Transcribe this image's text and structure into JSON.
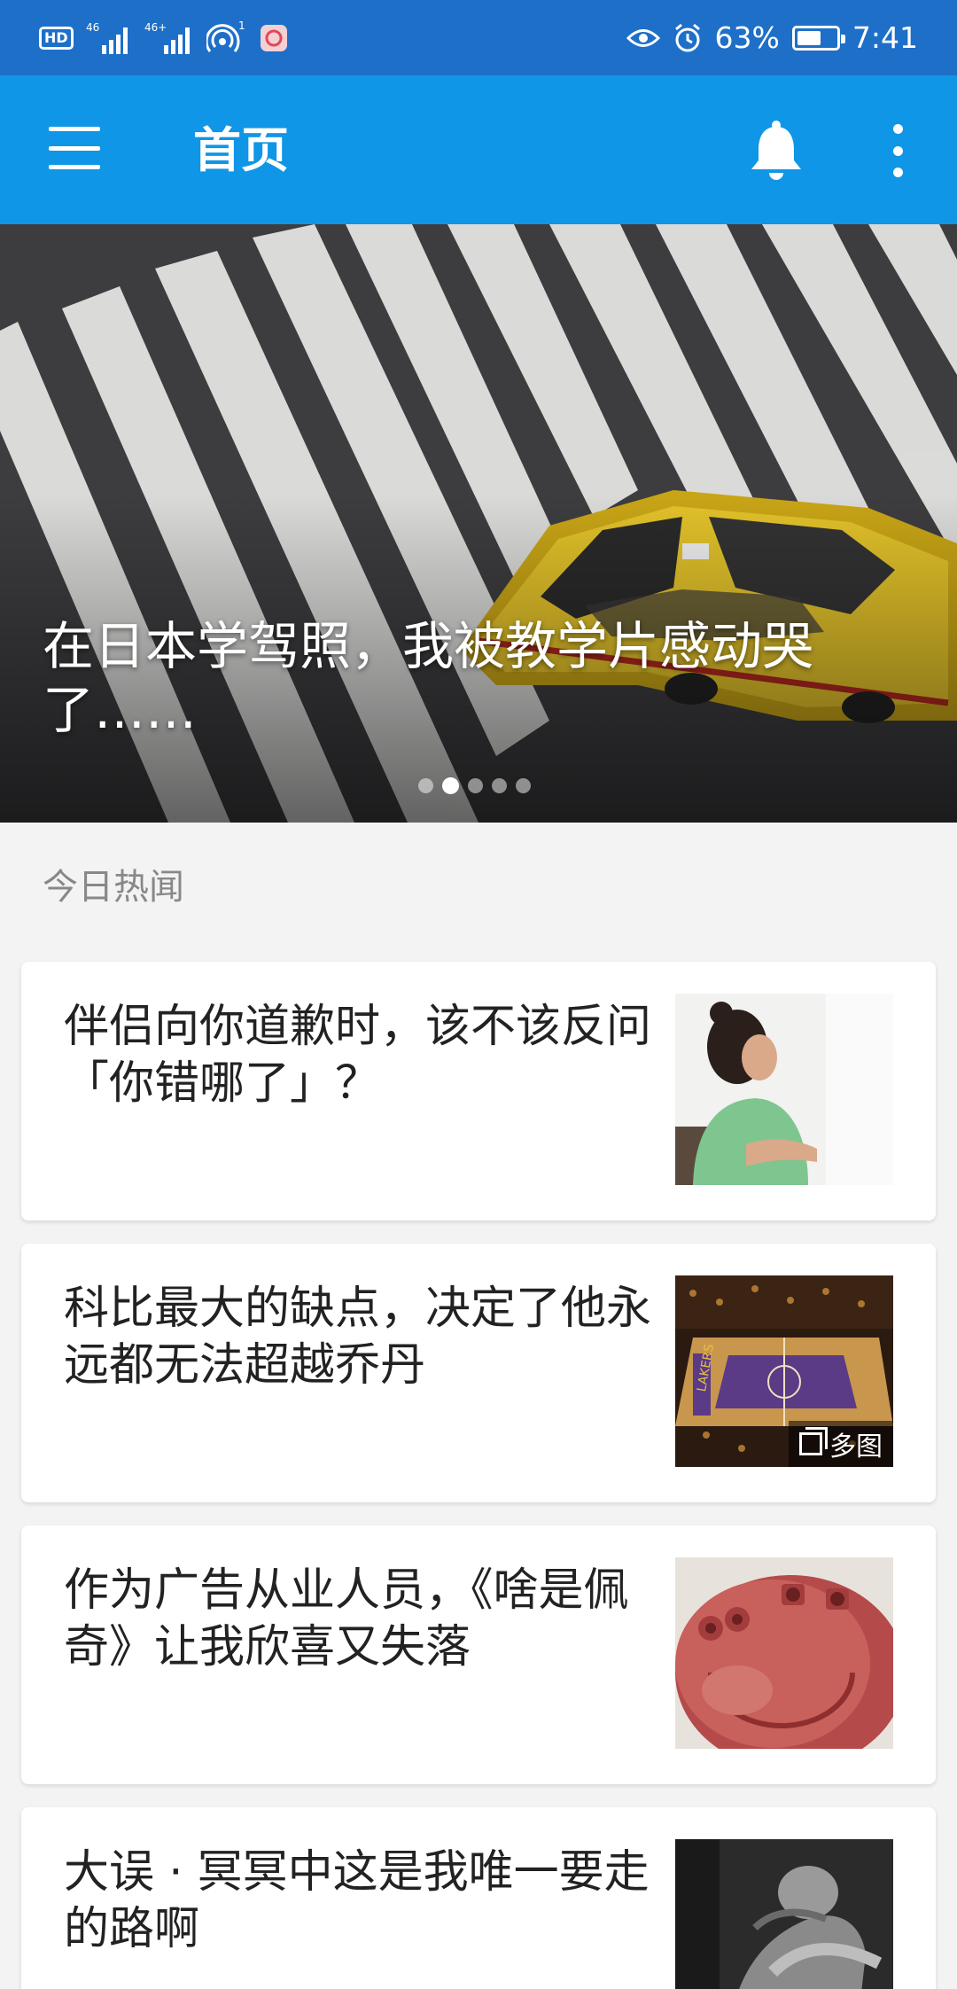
{
  "status_bar": {
    "hd": "HD",
    "signal1": "46",
    "signal2": "46+",
    "hotspot_count": "1",
    "battery_percent": "63%",
    "battery_level": 0.63,
    "time": "7:41",
    "icons": [
      "hd-icon",
      "signal-icon",
      "signal-icon",
      "hotspot-icon",
      "app-notification-icon",
      "eye-comfort-icon",
      "alarm-icon",
      "battery-icon"
    ]
  },
  "app_bar": {
    "title": "首页",
    "background": "#0f96e6",
    "icons": [
      "menu-icon",
      "bell-icon",
      "more-vertical-icon"
    ]
  },
  "hero": {
    "title": "在日本学驾照，我被教学片感动哭了……",
    "slide_count": 5,
    "active_slide": 2
  },
  "section": {
    "label": "今日热闻"
  },
  "stories": [
    {
      "title": "伴侣向你道歉时，该不该反问「你错哪了」？",
      "thumbnail": "woman-in-green-sweater",
      "multi_image": false
    },
    {
      "title": "科比最大的缺点，决定了他永远都无法超越乔丹",
      "thumbnail": "basketball-court",
      "multi_image": true,
      "badge": "多图"
    },
    {
      "title": "作为广告从业人员，《啥是佩奇》让我欣喜又失落",
      "thumbnail": "pink-peppa-sculpture",
      "multi_image": false
    },
    {
      "title": "大误 · 冥冥中这是我唯一要走的路啊",
      "thumbnail": "bw-athlete",
      "multi_image": false
    }
  ]
}
